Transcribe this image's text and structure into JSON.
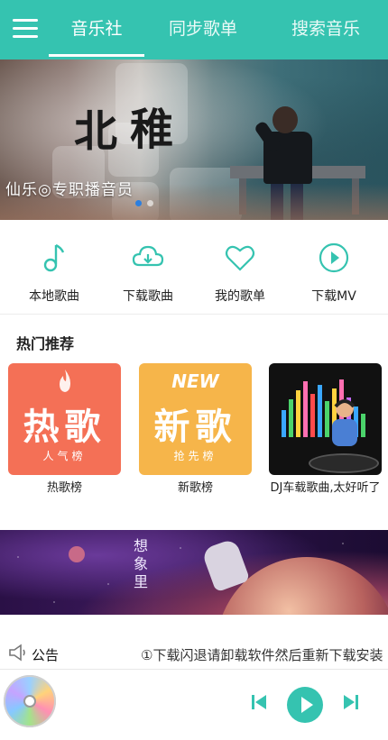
{
  "topbar": {
    "menu_icon": "hamburger-menu-icon",
    "tabs": [
      {
        "label": "音乐社",
        "active": true
      },
      {
        "label": "同步歌单",
        "active": false
      },
      {
        "label": "搜索音乐",
        "active": false
      }
    ],
    "accent_color": "#35c3b0"
  },
  "banner": {
    "calligraphy_left": "北",
    "calligraphy_right": "稚",
    "caption": "仙乐◎专职播音员",
    "slide_count": 2,
    "active_slide": 1
  },
  "quick_actions": [
    {
      "label": "本地歌曲",
      "icon": "music-note-icon"
    },
    {
      "label": "下载歌曲",
      "icon": "cloud-download-icon"
    },
    {
      "label": "我的歌单",
      "icon": "heart-icon"
    },
    {
      "label": "下载MV",
      "icon": "play-circle-icon"
    }
  ],
  "hot": {
    "title": "热门推荐",
    "cards": [
      {
        "caption": "热歌榜",
        "art_big": "热歌",
        "art_sub": "人气榜"
      },
      {
        "caption": "新歌榜",
        "art_big": "新歌",
        "art_sub": "抢先榜",
        "art_tag": "NEW"
      },
      {
        "caption": "DJ车载歌曲,太好听了"
      }
    ]
  },
  "banner2": {
    "vertical_title": "想象里"
  },
  "notice": {
    "label": "公告",
    "text": "①下载闪退请卸载软件然后重新下载安装"
  },
  "player": {
    "disc_icon": "album-disc-icon",
    "prev_icon": "skip-previous-icon",
    "play_icon": "play-icon",
    "next_icon": "skip-next-icon"
  }
}
